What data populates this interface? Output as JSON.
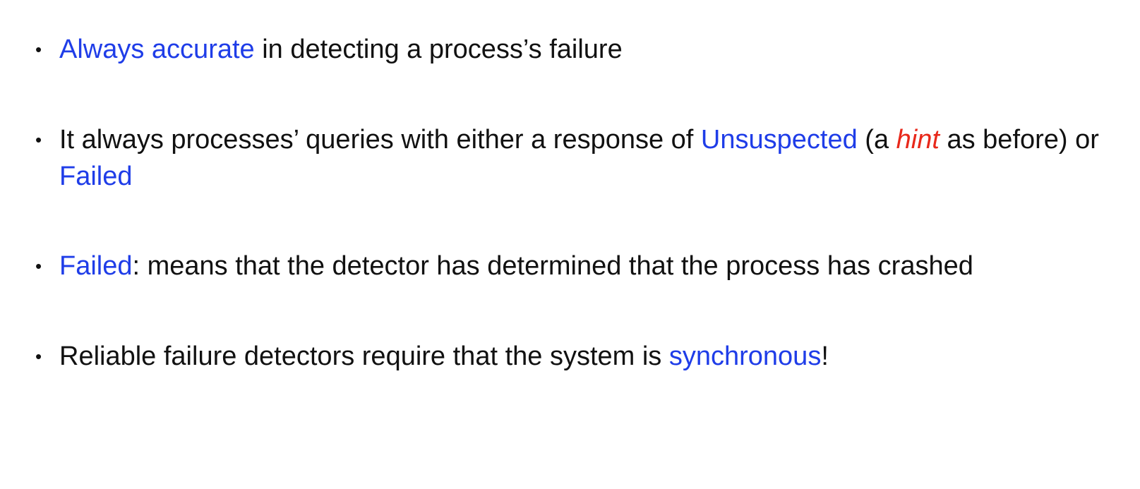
{
  "bullets": [
    {
      "symbol": "•",
      "segments": [
        {
          "text": "Always accurate",
          "style": "blue"
        },
        {
          "text": " in detecting a process’s failure",
          "style": "plain"
        }
      ]
    },
    {
      "symbol": "•",
      "segments": [
        {
          "text": "It always processes’ queries with either a response of ",
          "style": "plain"
        },
        {
          "text": "Unsuspected",
          "style": "blue"
        },
        {
          "text": " (a ",
          "style": "plain"
        },
        {
          "text": "hint",
          "style": "red-italic"
        },
        {
          "text": " as before) or ",
          "style": "plain"
        },
        {
          "text": "Failed",
          "style": "blue"
        }
      ]
    },
    {
      "symbol": "•",
      "segments": [
        {
          "text": "Failed",
          "style": "blue"
        },
        {
          "text": ": means that the detector has determined that the process has crashed",
          "style": "plain"
        }
      ]
    },
    {
      "symbol": "•",
      "segments": [
        {
          "text": "Reliable failure detectors require that the system is ",
          "style": "plain"
        },
        {
          "text": "synchronous",
          "style": "blue"
        },
        {
          "text": "!",
          "style": "plain"
        }
      ]
    }
  ],
  "colors": {
    "text": "#111111",
    "highlight_blue": "#1f3de8",
    "highlight_red": "#e8281a",
    "background": "#ffffff"
  }
}
